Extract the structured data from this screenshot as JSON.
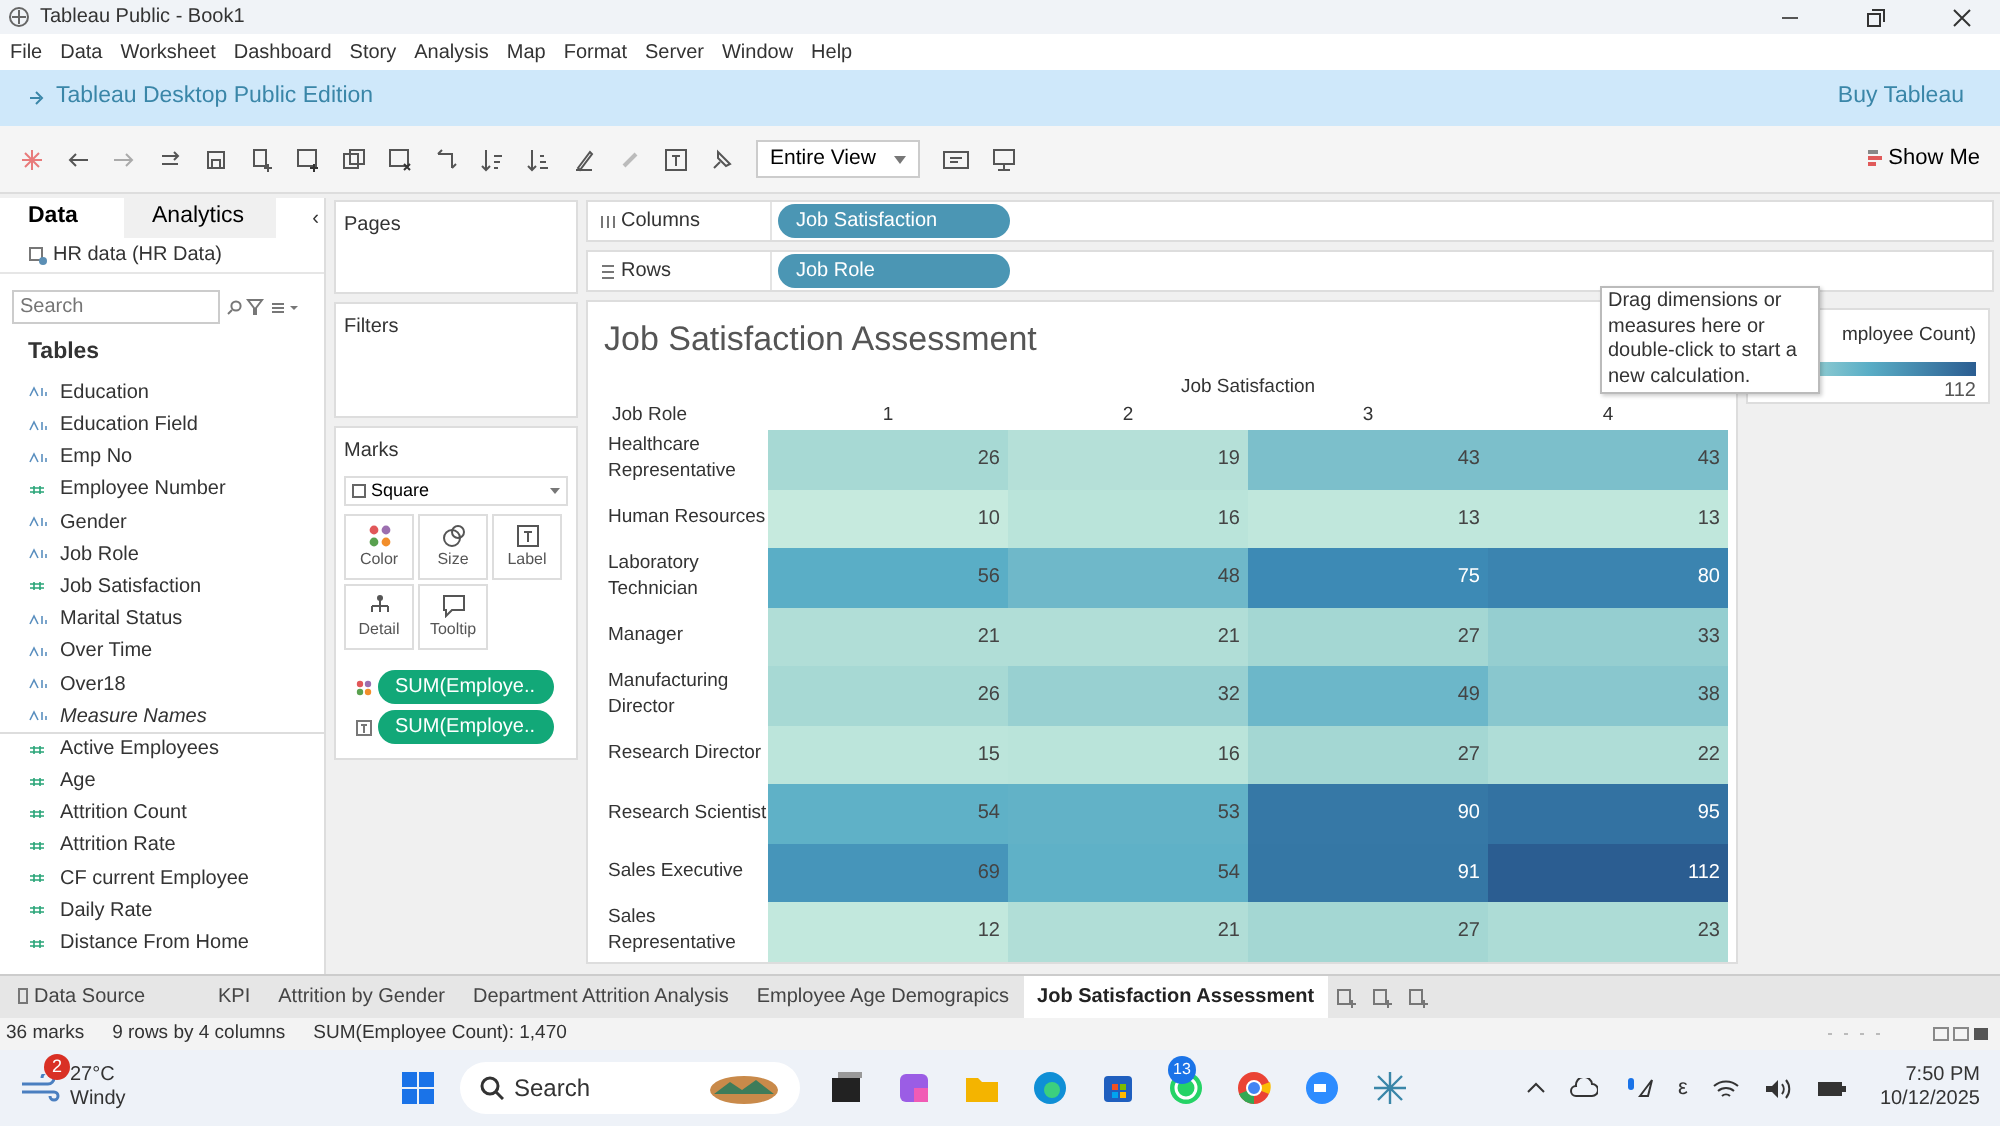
{
  "window": {
    "title": "Tableau Public - Book1"
  },
  "menu": [
    "File",
    "Data",
    "Worksheet",
    "Dashboard",
    "Story",
    "Analysis",
    "Map",
    "Format",
    "Server",
    "Window",
    "Help"
  ],
  "banner": {
    "edition": "Tableau Desktop Public Edition",
    "buy": "Buy Tableau"
  },
  "toolbar": {
    "fit": "Entire View",
    "show_me": "Show Me"
  },
  "data_pane": {
    "tabs": [
      {
        "label": "Data",
        "selected": true
      },
      {
        "label": "Analytics",
        "selected": false
      }
    ],
    "collapse": "‹",
    "source": "HR data (HR Data)",
    "search": {
      "placeholder": "Search"
    },
    "tables_heading": "Tables",
    "fields": [
      {
        "name": "Education",
        "kind": "dimension",
        "italic": false
      },
      {
        "name": "Education Field",
        "kind": "dimension",
        "italic": false
      },
      {
        "name": "Emp No",
        "kind": "dimension",
        "italic": false
      },
      {
        "name": "Employee Number",
        "kind": "measure",
        "italic": false
      },
      {
        "name": "Gender",
        "kind": "dimension",
        "italic": false
      },
      {
        "name": "Job Role",
        "kind": "dimension",
        "italic": false
      },
      {
        "name": "Job Satisfaction",
        "kind": "measure",
        "italic": false
      },
      {
        "name": "Marital Status",
        "kind": "dimension",
        "italic": false
      },
      {
        "name": "Over Time",
        "kind": "dimension",
        "italic": false
      },
      {
        "name": "Over18",
        "kind": "dimension",
        "italic": false
      },
      {
        "name": "Measure Names",
        "kind": "dimension",
        "italic": true
      },
      {
        "name": "Active Employees",
        "kind": "measure",
        "italic": false
      },
      {
        "name": "Age",
        "kind": "measure",
        "italic": false
      },
      {
        "name": "Attrition Count",
        "kind": "measure",
        "italic": false
      },
      {
        "name": "Attrition Rate",
        "kind": "measure",
        "italic": false
      },
      {
        "name": "CF current Employee",
        "kind": "measure",
        "italic": false
      },
      {
        "name": "Daily Rate",
        "kind": "measure",
        "italic": false
      },
      {
        "name": "Distance From Home",
        "kind": "measure",
        "italic": false
      }
    ]
  },
  "pages": {
    "title": "Pages"
  },
  "filters": {
    "title": "Filters"
  },
  "marks": {
    "title": "Marks",
    "type": "Square",
    "cards": [
      {
        "label": "Color",
        "kind": "color"
      },
      {
        "label": "Size",
        "kind": "size"
      },
      {
        "label": "Label",
        "kind": "label"
      },
      {
        "label": "Detail",
        "kind": "detail"
      },
      {
        "label": "Tooltip",
        "kind": "tooltip"
      }
    ],
    "pills": [
      {
        "text": "SUM(Employe..",
        "kind": "color"
      },
      {
        "text": "SUM(Employe..",
        "kind": "label"
      }
    ]
  },
  "shelves": [
    {
      "label": "Columns",
      "kind": "columns",
      "pill": "Job Satisfaction"
    },
    {
      "label": "Rows",
      "kind": "rows",
      "pill": "Job Role"
    }
  ],
  "view": {
    "title": "Job Satisfaction Assessment",
    "column_header": "Job Satisfaction",
    "row_header": "Job Role",
    "columns": [
      "1",
      "2",
      "3",
      "4"
    ],
    "rows": [
      {
        "role": "Healthcare Representative",
        "values": [
          "26",
          "19",
          "43",
          "43"
        ]
      },
      {
        "role": "Human Resources",
        "values": [
          "10",
          "16",
          "13",
          "13"
        ]
      },
      {
        "role": "Laboratory Technician",
        "values": [
          "56",
          "48",
          "75",
          "80"
        ]
      },
      {
        "role": "Manager",
        "values": [
          "21",
          "21",
          "27",
          "33"
        ]
      },
      {
        "role": "Manufacturing Director",
        "values": [
          "26",
          "32",
          "49",
          "38"
        ]
      },
      {
        "role": "Research Director",
        "values": [
          "15",
          "16",
          "27",
          "22"
        ]
      },
      {
        "role": "Research Scientist",
        "values": [
          "54",
          "53",
          "90",
          "95"
        ]
      },
      {
        "role": "Sales Executive",
        "values": [
          "69",
          "54",
          "91",
          "112"
        ]
      },
      {
        "role": "Sales Representative",
        "values": [
          "12",
          "21",
          "27",
          "23"
        ]
      }
    ]
  },
  "legend": {
    "title": "mployee Count)",
    "max": "112"
  },
  "tooltip": "Drag dimensions or measures here or double-click to start a new calculation.",
  "sheet_tabs": [
    {
      "label": "Data Source",
      "selected": false
    },
    {
      "label": "KPI",
      "selected": false
    },
    {
      "label": "Attrition by Gender",
      "selected": false
    },
    {
      "label": "Department Attrition Analysis",
      "selected": false
    },
    {
      "label": "Employee Age Demograpics",
      "selected": false
    },
    {
      "label": "Job Satisfaction Assessment",
      "selected": true
    }
  ],
  "status_bar": [
    "36 marks",
    "9 rows by 4 columns",
    "SUM(Employee Count): 1,470"
  ],
  "taskbar": {
    "weather": {
      "badge": "2",
      "temp": "27°C",
      "desc": "Windy"
    },
    "search": "Search",
    "whatsapp_badge": "13",
    "lang": "ε",
    "time": "7:50 PM",
    "date": "10/12/2025"
  }
}
